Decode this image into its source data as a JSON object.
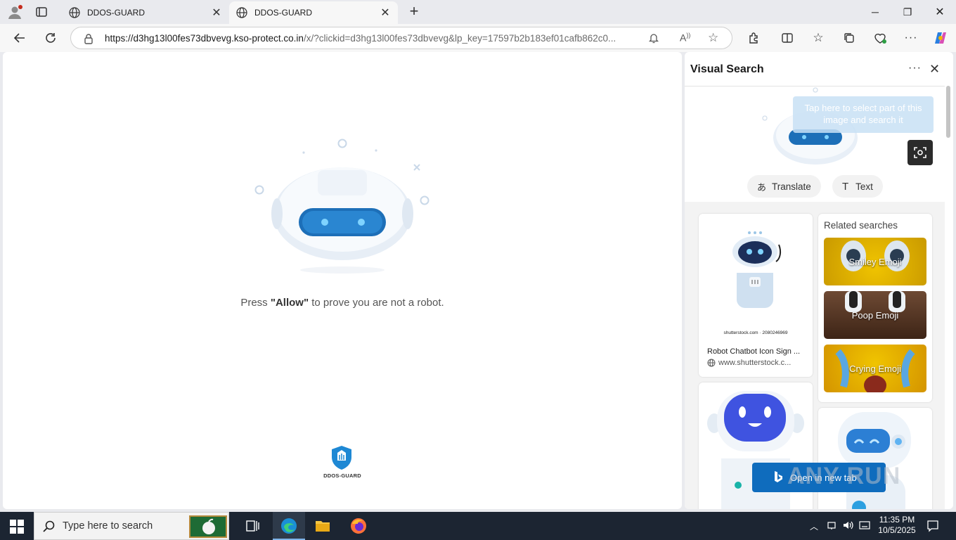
{
  "browser": {
    "tabs": [
      {
        "title": "DDOS-GUARD",
        "active": false
      },
      {
        "title": "DDOS-GUARD",
        "active": true
      }
    ],
    "url_host": "https://d3hg13l00fes73dbvevg.kso-protect.co.in",
    "url_rest": "/x/?clickid=d3hg13l00fes73dbvevg&lp_key=17597b2b183ef01cafb862c0..."
  },
  "page": {
    "prompt_before": "Press ",
    "prompt_bold": "\"Allow\"",
    "prompt_after": " to prove you are not a robot.",
    "logo_text": "DDOS-GUARD"
  },
  "visual_search": {
    "title": "Visual Search",
    "tooltip": "Tap here to select part of this image and search it",
    "translate_label": "Translate",
    "text_label": "Text",
    "result_1": {
      "caption_small": "shutterstock.com · 2080246969",
      "title": "Robot Chatbot Icon Sign ...",
      "source": "www.shutterstock.c..."
    },
    "related_heading": "Related searches",
    "related": [
      "Smiley Emoji",
      "Poop Emoji",
      "Crying Emoji"
    ],
    "open_new_tab": "Open in new tab"
  },
  "watermark": "ANY RUN",
  "taskbar": {
    "search_placeholder": "Type here to search",
    "time": "11:35 PM",
    "date": "10/5/2025"
  },
  "colors": {
    "accent": "#0f6cbd",
    "robot_visor": "#1d6fb8",
    "taskbar": "#1c2532"
  }
}
